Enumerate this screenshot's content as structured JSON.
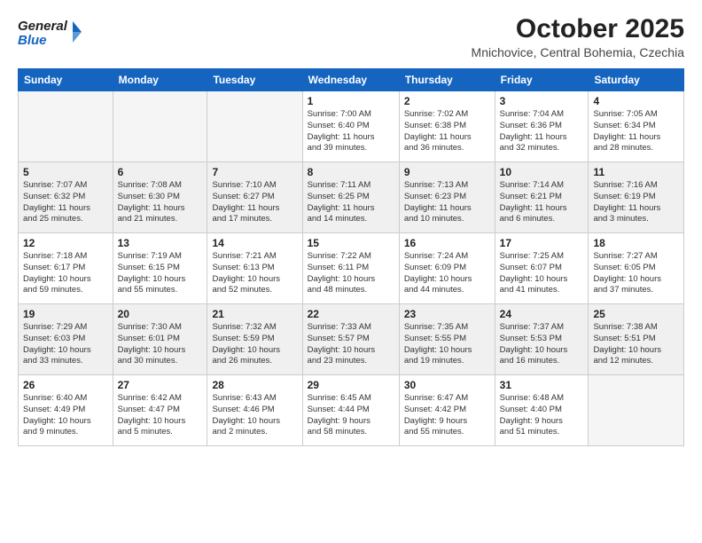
{
  "header": {
    "logo_general": "General",
    "logo_blue": "Blue",
    "month_title": "October 2025",
    "location": "Mnichovice, Central Bohemia, Czechia"
  },
  "weekdays": [
    "Sunday",
    "Monday",
    "Tuesday",
    "Wednesday",
    "Thursday",
    "Friday",
    "Saturday"
  ],
  "weeks": [
    [
      {
        "day": "",
        "info": "",
        "empty": true
      },
      {
        "day": "",
        "info": "",
        "empty": true
      },
      {
        "day": "",
        "info": "",
        "empty": true
      },
      {
        "day": "1",
        "info": "Sunrise: 7:00 AM\nSunset: 6:40 PM\nDaylight: 11 hours\nand 39 minutes."
      },
      {
        "day": "2",
        "info": "Sunrise: 7:02 AM\nSunset: 6:38 PM\nDaylight: 11 hours\nand 36 minutes."
      },
      {
        "day": "3",
        "info": "Sunrise: 7:04 AM\nSunset: 6:36 PM\nDaylight: 11 hours\nand 32 minutes."
      },
      {
        "day": "4",
        "info": "Sunrise: 7:05 AM\nSunset: 6:34 PM\nDaylight: 11 hours\nand 28 minutes."
      }
    ],
    [
      {
        "day": "5",
        "info": "Sunrise: 7:07 AM\nSunset: 6:32 PM\nDaylight: 11 hours\nand 25 minutes.",
        "shaded": true
      },
      {
        "day": "6",
        "info": "Sunrise: 7:08 AM\nSunset: 6:30 PM\nDaylight: 11 hours\nand 21 minutes.",
        "shaded": true
      },
      {
        "day": "7",
        "info": "Sunrise: 7:10 AM\nSunset: 6:27 PM\nDaylight: 11 hours\nand 17 minutes.",
        "shaded": true
      },
      {
        "day": "8",
        "info": "Sunrise: 7:11 AM\nSunset: 6:25 PM\nDaylight: 11 hours\nand 14 minutes.",
        "shaded": true
      },
      {
        "day": "9",
        "info": "Sunrise: 7:13 AM\nSunset: 6:23 PM\nDaylight: 11 hours\nand 10 minutes.",
        "shaded": true
      },
      {
        "day": "10",
        "info": "Sunrise: 7:14 AM\nSunset: 6:21 PM\nDaylight: 11 hours\nand 6 minutes.",
        "shaded": true
      },
      {
        "day": "11",
        "info": "Sunrise: 7:16 AM\nSunset: 6:19 PM\nDaylight: 11 hours\nand 3 minutes.",
        "shaded": true
      }
    ],
    [
      {
        "day": "12",
        "info": "Sunrise: 7:18 AM\nSunset: 6:17 PM\nDaylight: 10 hours\nand 59 minutes."
      },
      {
        "day": "13",
        "info": "Sunrise: 7:19 AM\nSunset: 6:15 PM\nDaylight: 10 hours\nand 55 minutes."
      },
      {
        "day": "14",
        "info": "Sunrise: 7:21 AM\nSunset: 6:13 PM\nDaylight: 10 hours\nand 52 minutes."
      },
      {
        "day": "15",
        "info": "Sunrise: 7:22 AM\nSunset: 6:11 PM\nDaylight: 10 hours\nand 48 minutes."
      },
      {
        "day": "16",
        "info": "Sunrise: 7:24 AM\nSunset: 6:09 PM\nDaylight: 10 hours\nand 44 minutes."
      },
      {
        "day": "17",
        "info": "Sunrise: 7:25 AM\nSunset: 6:07 PM\nDaylight: 10 hours\nand 41 minutes."
      },
      {
        "day": "18",
        "info": "Sunrise: 7:27 AM\nSunset: 6:05 PM\nDaylight: 10 hours\nand 37 minutes."
      }
    ],
    [
      {
        "day": "19",
        "info": "Sunrise: 7:29 AM\nSunset: 6:03 PM\nDaylight: 10 hours\nand 33 minutes.",
        "shaded": true
      },
      {
        "day": "20",
        "info": "Sunrise: 7:30 AM\nSunset: 6:01 PM\nDaylight: 10 hours\nand 30 minutes.",
        "shaded": true
      },
      {
        "day": "21",
        "info": "Sunrise: 7:32 AM\nSunset: 5:59 PM\nDaylight: 10 hours\nand 26 minutes.",
        "shaded": true
      },
      {
        "day": "22",
        "info": "Sunrise: 7:33 AM\nSunset: 5:57 PM\nDaylight: 10 hours\nand 23 minutes.",
        "shaded": true
      },
      {
        "day": "23",
        "info": "Sunrise: 7:35 AM\nSunset: 5:55 PM\nDaylight: 10 hours\nand 19 minutes.",
        "shaded": true
      },
      {
        "day": "24",
        "info": "Sunrise: 7:37 AM\nSunset: 5:53 PM\nDaylight: 10 hours\nand 16 minutes.",
        "shaded": true
      },
      {
        "day": "25",
        "info": "Sunrise: 7:38 AM\nSunset: 5:51 PM\nDaylight: 10 hours\nand 12 minutes.",
        "shaded": true
      }
    ],
    [
      {
        "day": "26",
        "info": "Sunrise: 6:40 AM\nSunset: 4:49 PM\nDaylight: 10 hours\nand 9 minutes."
      },
      {
        "day": "27",
        "info": "Sunrise: 6:42 AM\nSunset: 4:47 PM\nDaylight: 10 hours\nand 5 minutes."
      },
      {
        "day": "28",
        "info": "Sunrise: 6:43 AM\nSunset: 4:46 PM\nDaylight: 10 hours\nand 2 minutes."
      },
      {
        "day": "29",
        "info": "Sunrise: 6:45 AM\nSunset: 4:44 PM\nDaylight: 9 hours\nand 58 minutes."
      },
      {
        "day": "30",
        "info": "Sunrise: 6:47 AM\nSunset: 4:42 PM\nDaylight: 9 hours\nand 55 minutes."
      },
      {
        "day": "31",
        "info": "Sunrise: 6:48 AM\nSunset: 4:40 PM\nDaylight: 9 hours\nand 51 minutes."
      },
      {
        "day": "",
        "info": "",
        "empty": true
      }
    ]
  ]
}
